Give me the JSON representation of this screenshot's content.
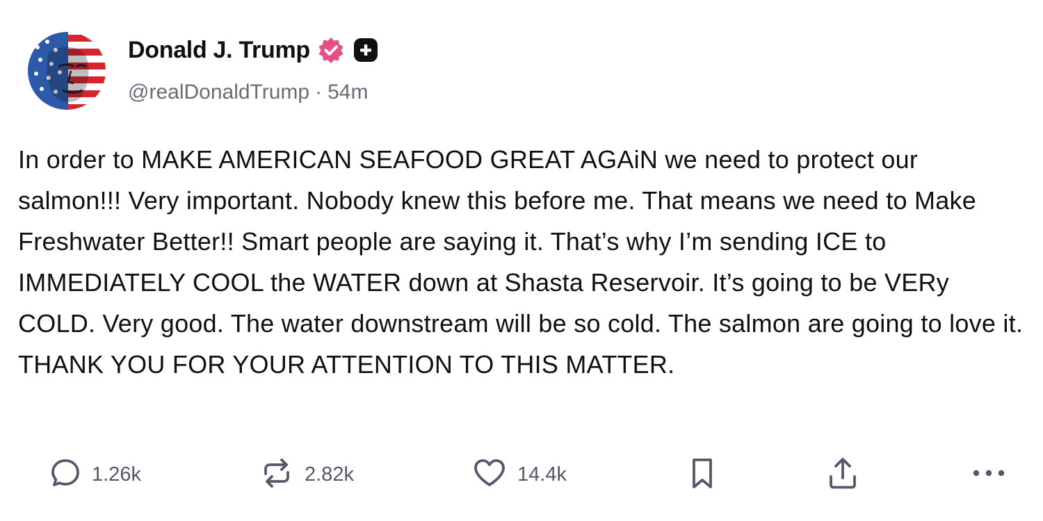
{
  "author": {
    "display_name": "Donald J. Trump",
    "handle": "@realDonaldTrump",
    "separator": "·",
    "time_ago": "54m",
    "avatar_icon": "flag-portrait-avatar",
    "verified_icon": "verified-badge-icon",
    "verified_color": "#e74f87",
    "plus_badge_icon": "plus-badge-icon"
  },
  "post": {
    "text": "In order to MAKE AMERICAN SEAFOOD GREAT AGAiN we need to protect our salmon!!! Very important. Nobody knew this before me. That means we need to Make Freshwater Better!! Smart people are saying it. That’s why I’m sending ICE to IMMEDIATELY COOL the WATER down at Shasta Reservoir. It’s going to be VERy COLD. Very good. The water downstream will be so cold. The salmon are going to love it. THANK YOU FOR YOUR ATTENTION TO THIS MATTER."
  },
  "actions": {
    "replies": "1.26k",
    "retruths": "2.82k",
    "likes": "14.4k",
    "reply_icon": "reply-icon",
    "retruth_icon": "retruth-icon",
    "like_icon": "heart-icon",
    "bookmark_icon": "bookmark-icon",
    "share_icon": "share-icon",
    "more_icon": "more-icon"
  },
  "colors": {
    "text": "#0f0f14",
    "muted": "#6b6a78",
    "icon": "#57566a",
    "verified": "#e74f87"
  }
}
